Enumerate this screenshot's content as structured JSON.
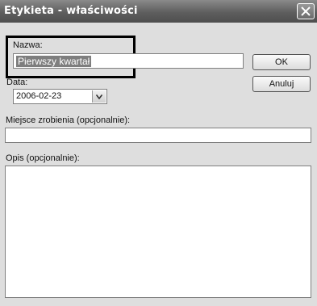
{
  "window": {
    "title": "Etykieta - właściwości"
  },
  "name": {
    "label": "Nazwa:",
    "value": "Pierwszy kwartał"
  },
  "date": {
    "label": "Data:",
    "value": "2006-02-23"
  },
  "place": {
    "label": "Miejsce zrobienia (opcjonalnie):",
    "value": ""
  },
  "description": {
    "label": "Opis (opcjonalnie):",
    "value": ""
  },
  "buttons": {
    "ok": "OK",
    "cancel": "Anuluj"
  },
  "icons": {
    "close": "close-icon",
    "dropdown": "chevron-down-icon"
  }
}
